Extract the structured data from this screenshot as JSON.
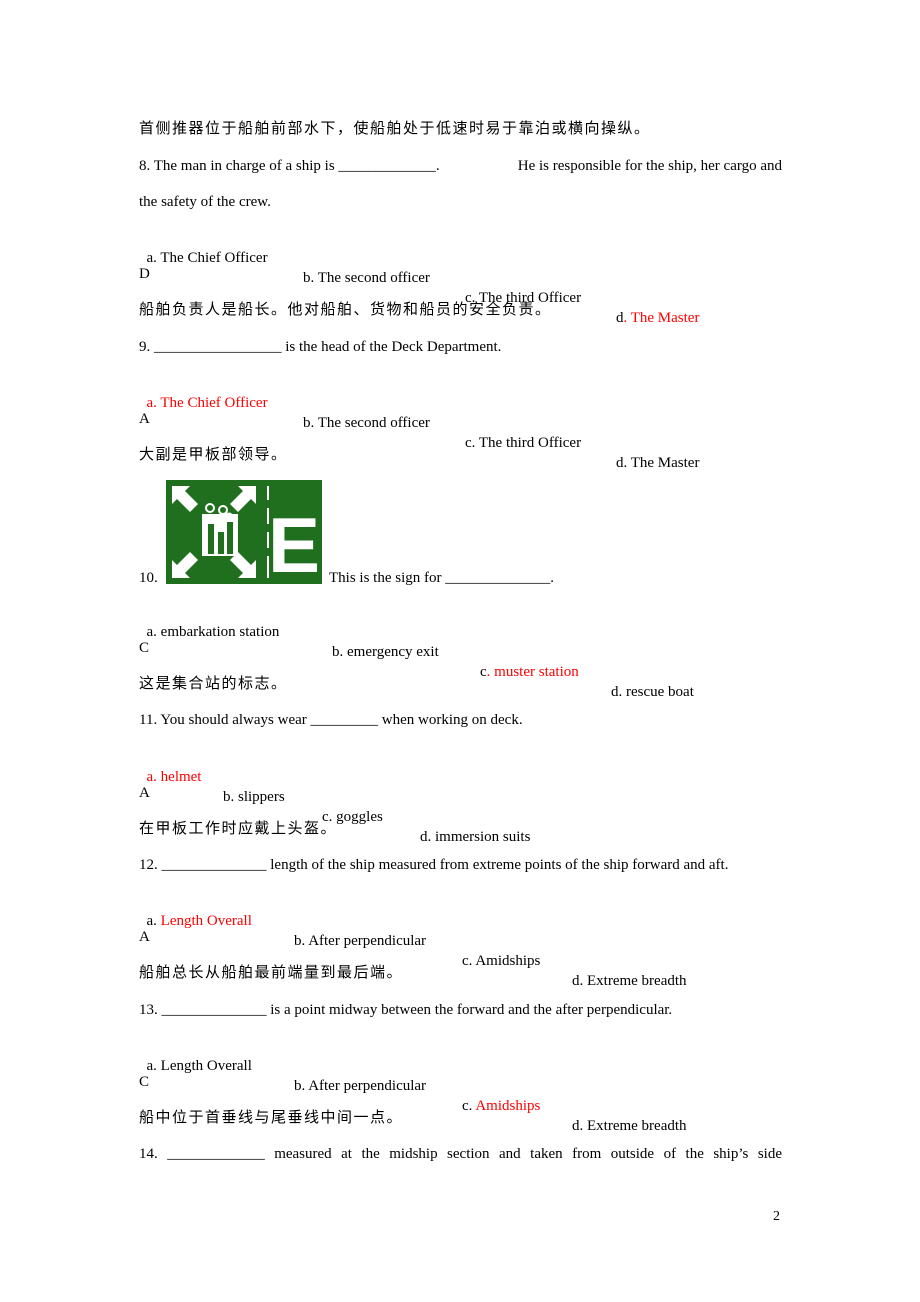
{
  "page": {
    "page_number": "2",
    "intro_explanation": "首侧推器位于船舶前部水下，使船舶处于低速时易于靠泊或横向操纵。",
    "questions": [
      {
        "number": "8.",
        "stem_line1_a": " The man in charge of a ship is _____________.",
        "stem_line1_b": "He is responsible for the ship, her cargo and",
        "stem_line2": "the safety of the crew.",
        "options": [
          {
            "prefix": "a. ",
            "text": "The Chief Officer"
          },
          {
            "prefix": "b. ",
            "text": "The second officer"
          },
          {
            "prefix": "c. ",
            "text": "The third Officer"
          },
          {
            "prefix": "d",
            "text": ". The Master"
          }
        ],
        "correct_index": 3,
        "answer": "D",
        "explanation": "船舶负责人是船长。他对船舶、货物和船员的安全负责。"
      },
      {
        "number": "9.",
        "stem": " _________________ is the head of the Deck Department.",
        "options": [
          {
            "prefix": "",
            "text": "a. The Chief Officer"
          },
          {
            "prefix": "b. ",
            "text": "The second officer"
          },
          {
            "prefix": "c. ",
            "text": "The third Officer"
          },
          {
            "prefix": "d. ",
            "text": "The Master"
          }
        ],
        "correct_index": 0,
        "answer": "A",
        "explanation": "大副是甲板部领导。"
      },
      {
        "number": "10.",
        "image": "muster-station-sign",
        "sign_letter": "E",
        "sign_color": "#1f6f1f",
        "stem": "This is the sign for ______________.",
        "options": [
          {
            "prefix": "a. ",
            "text": "embarkation station"
          },
          {
            "prefix": "b. ",
            "text": "emergency exit"
          },
          {
            "prefix": "c",
            "text": ". muster station"
          },
          {
            "prefix": "d. ",
            "text": "rescue boat"
          }
        ],
        "correct_index": 2,
        "answer": "C",
        "explanation": "这是集合站的标志。"
      },
      {
        "number": "11.",
        "stem": " You should always wear _________ when working on deck.",
        "options": [
          {
            "prefix": "",
            "text": "a. helmet"
          },
          {
            "prefix": "b. ",
            "text": "slippers"
          },
          {
            "prefix": "c. ",
            "text": "goggles"
          },
          {
            "prefix": "d. ",
            "text": "immersion suits"
          }
        ],
        "correct_index": 0,
        "answer": "A",
        "explanation": "在甲板工作时应戴上头盔。"
      },
      {
        "number": "12.",
        "stem": " ______________ length of the ship measured from extreme points of the ship forward and aft.",
        "options": [
          {
            "prefix": "a. ",
            "text": "Length Overall"
          },
          {
            "prefix": "b. ",
            "text": "After perpendicular"
          },
          {
            "prefix": "c. ",
            "text": "Amidships"
          },
          {
            "prefix": "d. ",
            "text": "Extreme breadth"
          }
        ],
        "correct_index": 0,
        "answer": "A",
        "explanation": "船舶总长从船舶最前端量到最后端。"
      },
      {
        "number": "13.",
        "stem": " ______________ is a point midway between the forward and the after perpendicular.",
        "options": [
          {
            "prefix": "a. ",
            "text": "Length Overall"
          },
          {
            "prefix": "b. ",
            "text": "After perpendicular"
          },
          {
            "prefix": "c. ",
            "text": "Amidships"
          },
          {
            "prefix": "d. ",
            "text": "Extreme breadth"
          }
        ],
        "correct_index": 2,
        "answer": "C",
        "explanation": "船中位于首垂线与尾垂线中间一点。"
      },
      {
        "number": "14.",
        "stem_words": [
          "_____________",
          "measured",
          "at",
          "the",
          "midship",
          "section",
          "and",
          "taken",
          "from",
          "outside",
          "of",
          "the",
          "ship’s",
          "side"
        ]
      }
    ]
  },
  "colors": {
    "answer_highlight": "#ff0000",
    "text": "#000000"
  }
}
